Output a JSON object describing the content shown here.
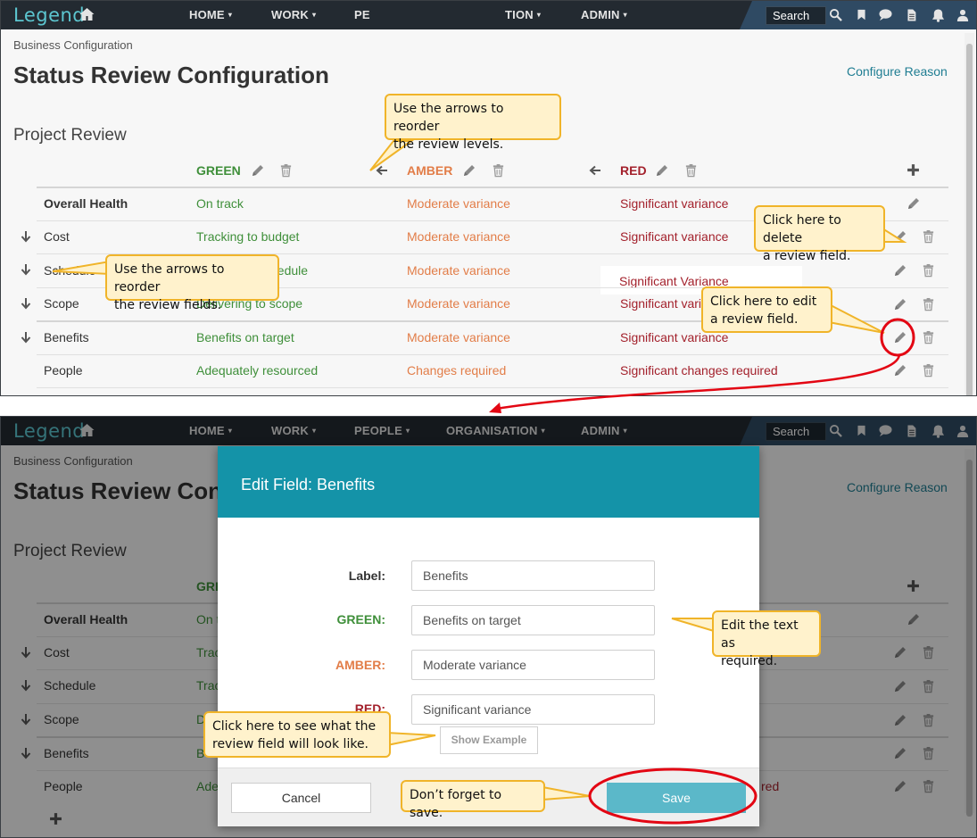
{
  "app": {
    "logo": "Legend",
    "nav_top": [
      {
        "label": "HOME",
        "caret": "▾"
      },
      {
        "label": "WORK",
        "caret": "▾"
      },
      {
        "label": "PE",
        "caret": ""
      },
      {
        "label": "TION",
        "caret": "▾"
      },
      {
        "label": "ADMIN",
        "caret": "▾"
      }
    ],
    "nav_bottom": [
      {
        "label": "HOME",
        "caret": "▾"
      },
      {
        "label": "WORK",
        "caret": "▾"
      },
      {
        "label": "PEOPLE",
        "caret": "▾"
      },
      {
        "label": "ORGANISATION",
        "caret": "▾"
      },
      {
        "label": "ADMIN",
        "caret": "▾"
      }
    ],
    "search_label": "Search",
    "icons": [
      "home-icon",
      "search-icon",
      "bookmark-icon",
      "chat-icon",
      "document-icon",
      "bell-icon",
      "user-icon"
    ]
  },
  "page": {
    "breadcrumb": "Business Configuration",
    "title": "Status Review Configuration",
    "title_bottom": "Status Review Con",
    "configure_reason": "Configure Reason",
    "section": "Project Review"
  },
  "table": {
    "levels": [
      {
        "name": "GREEN",
        "color": "#3f8f3a"
      },
      {
        "name": "AMBER",
        "color": "#e27d48"
      },
      {
        "name": "RED",
        "color": "#a3212c"
      }
    ],
    "rows": [
      {
        "label": "Overall Health",
        "green": "On track",
        "amber": "Moderate variance",
        "red": "Significant variance"
      },
      {
        "label": "Cost",
        "green": "Tracking to budget",
        "amber": "Moderate variance",
        "red": "Significant variance"
      },
      {
        "label": "Schedule",
        "green": "hedule",
        "amber": "Moderate variance",
        "red": "Significant Variance"
      },
      {
        "label": "Scope",
        "green": "Delivering to scope",
        "amber": "Moderate variance",
        "red": "Significant vari"
      },
      {
        "label": "Benefits",
        "green": "Benefits on target",
        "amber": "Moderate variance",
        "red": "Significant variance"
      },
      {
        "label": "People",
        "green": "Adequately resourced",
        "amber": "Changes required",
        "red": "Significant changes required"
      }
    ],
    "bottom_rows": [
      {
        "label": "Overall Health",
        "green": "On t"
      },
      {
        "label": "Cost",
        "green": "Trac"
      },
      {
        "label": "Schedule",
        "green": "Trac"
      },
      {
        "label": "Scope",
        "green": "D"
      },
      {
        "label": "Benefits",
        "green": "B"
      },
      {
        "label": "People",
        "green": "Ade",
        "red": "red"
      }
    ],
    "bottom_header_green": "GRE"
  },
  "callouts": {
    "reorder_levels": [
      "Use the arrows to reorder",
      "the review levels."
    ],
    "reorder_fields": [
      "Use the arrows to reorder",
      "the review fields."
    ],
    "delete_field": [
      "Click here to delete",
      "a review field."
    ],
    "edit_field": [
      "Click here to edit",
      "a review field."
    ],
    "edit_text": [
      "Edit the text as",
      "required."
    ],
    "show_example": [
      "Click here to see what the",
      "review field will look like."
    ],
    "save": [
      "Don’t forget to save."
    ]
  },
  "modal": {
    "title": "Edit Field: Benefits",
    "fields": [
      {
        "label": "Label:",
        "value": "Benefits",
        "color": "#333333"
      },
      {
        "label": "GREEN:",
        "value": "Benefits on target",
        "color": "#3f8f3a"
      },
      {
        "label": "AMBER:",
        "value": "Moderate variance",
        "color": "#e27d48"
      },
      {
        "label": "RED:",
        "value": "Significant variance",
        "color": "#a3212c"
      }
    ],
    "show_example": "Show Example",
    "cancel": "Cancel",
    "save": "Save"
  },
  "colors": {
    "accent": "#1493a8",
    "callout_fill": "#fff2cc",
    "callout_border": "#f0b429",
    "highlight": "#e30613"
  }
}
